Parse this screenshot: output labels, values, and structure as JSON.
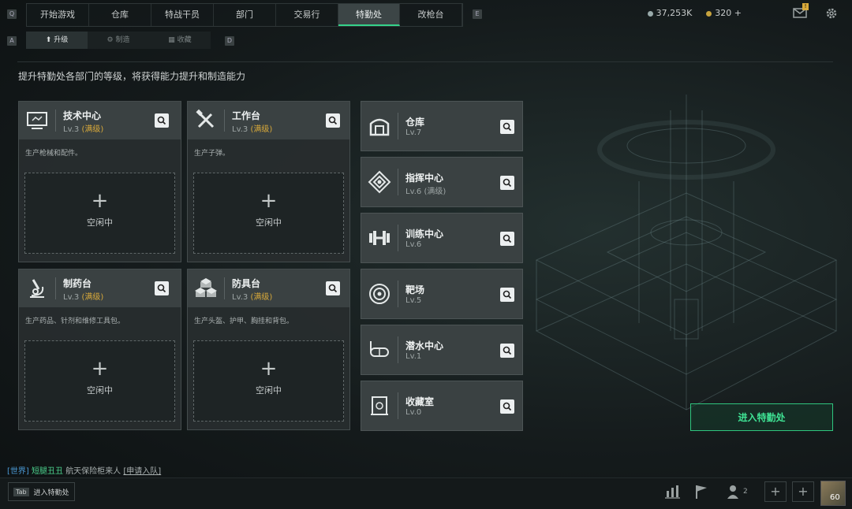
{
  "keys": {
    "prev_tab": "Q",
    "next_tab": "E",
    "prev_sub": "A",
    "next_sub": "D"
  },
  "nav": {
    "tabs": [
      "开始游戏",
      "仓库",
      "特战干员",
      "部门",
      "交易行",
      "特勤处",
      "改枪台"
    ],
    "active_index": 5
  },
  "currency": {
    "silver": "37,253K",
    "gold": "320"
  },
  "mail_badge": "!",
  "subtabs": [
    "升级",
    "制造",
    "收藏"
  ],
  "description": "提升特勤处各部门的等级，将获得能力提升和制造能力",
  "cards": [
    {
      "name": "技术中心",
      "level": "Lv.3",
      "max": "(满级)",
      "desc": "生产枪械和配件。",
      "slot_status": "空闲中",
      "icon": "computer-icon"
    },
    {
      "name": "工作台",
      "level": "Lv.3",
      "max": "(满级)",
      "desc": "生产子弹。",
      "slot_status": "空闲中",
      "icon": "tools-icon"
    },
    {
      "name": "制药台",
      "level": "Lv.3",
      "max": "(满级)",
      "desc": "生产药品、针剂和维修工具包。",
      "slot_status": "空闲中",
      "icon": "microscope-icon"
    },
    {
      "name": "防具台",
      "level": "Lv.3",
      "max": "(满级)",
      "desc": "生产头盔、护甲、胸挂和背包。",
      "slot_status": "空闲中",
      "icon": "boxes-icon"
    }
  ],
  "departments": [
    {
      "name": "仓库",
      "level": "Lv.7",
      "max": "",
      "icon": "warehouse-icon"
    },
    {
      "name": "指挥中心",
      "level": "Lv.6",
      "max": "(满级)",
      "icon": "command-icon"
    },
    {
      "name": "训练中心",
      "level": "Lv.6",
      "max": "",
      "icon": "dumbbell-icon"
    },
    {
      "name": "靶场",
      "level": "Lv.5",
      "max": "",
      "icon": "target-icon"
    },
    {
      "name": "潜水中心",
      "level": "Lv.1",
      "max": "",
      "icon": "diving-mask-icon"
    },
    {
      "name": "收藏室",
      "level": "Lv.0",
      "max": "",
      "icon": "collection-icon"
    }
  ],
  "enter_button": "进入特勤处",
  "chat": {
    "channel": "[世界]",
    "sender": "短腿丑丑",
    "message": "航天保险柜来人",
    "link": "[申请入队]"
  },
  "bottom": {
    "tab_key": "Tab",
    "tab_label": "进入特勤处",
    "friends_count": "2",
    "player_level": "60"
  },
  "colors": {
    "accent_green": "#35d38a",
    "max_level_gold": "#d8a93a"
  }
}
